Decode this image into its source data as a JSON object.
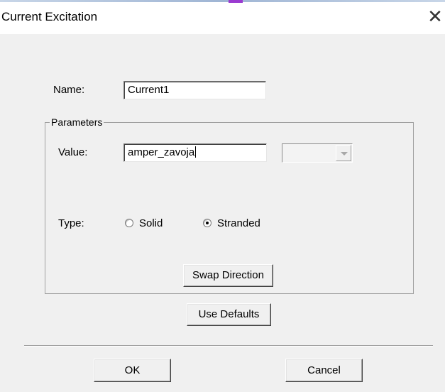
{
  "window": {
    "title": "Current Excitation",
    "close_glyph": "✕"
  },
  "form": {
    "name_label": "Name:",
    "name_value": "Current1",
    "parameters_label": "Parameters",
    "value_label": "Value:",
    "value_value": "amper_zavoja",
    "unit_selected": "",
    "type_label": "Type:",
    "type_options": [
      {
        "label": "Solid",
        "selected": false
      },
      {
        "label": "Stranded",
        "selected": true
      }
    ],
    "swap_direction_label": "Swap Direction",
    "use_defaults_label": "Use Defaults"
  },
  "footer": {
    "ok_label": "OK",
    "cancel_label": "Cancel"
  },
  "colors": {
    "dialog_bg": "#f0f0f0",
    "titlebar_bg": "#ffffff",
    "accent": "#9a3ad0"
  }
}
